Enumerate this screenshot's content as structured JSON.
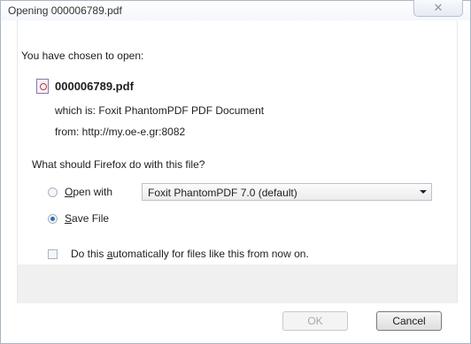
{
  "window": {
    "title": "Opening 000006789.pdf",
    "close_glyph": "✕"
  },
  "dialog": {
    "intro": "You have chosen to open:",
    "file_name": "000006789.pdf",
    "which_is": "which is: Foxit PhantomPDF PDF Document",
    "from": "from: http://my.oe-e.gr:8082",
    "question": "What should Firefox do with this file?"
  },
  "options": {
    "open_with_prefix": "",
    "open_with_accel": "O",
    "open_with_rest": "pen with",
    "open_with_selected": false,
    "application": "Foxit PhantomPDF 7.0 (default)",
    "save_accel": "S",
    "save_rest": "ave File",
    "save_selected": true,
    "auto_pre": "Do this ",
    "auto_accel": "a",
    "auto_rest": "utomatically for files like this from now on.",
    "auto_checked": false
  },
  "buttons": {
    "ok": "OK",
    "cancel": "Cancel"
  }
}
